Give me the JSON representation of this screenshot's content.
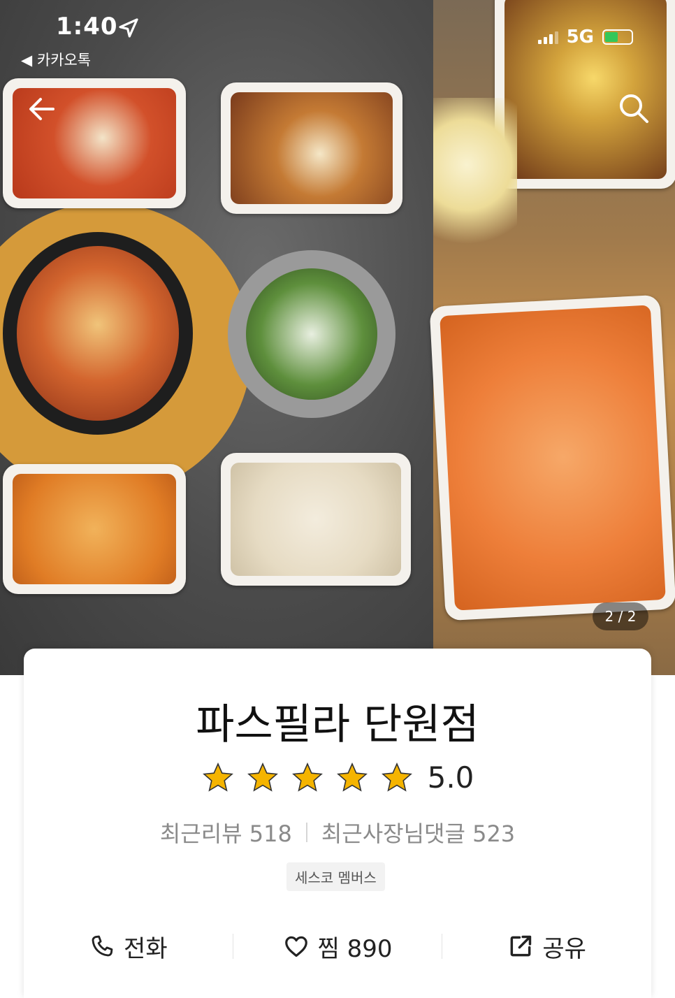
{
  "status_bar": {
    "time": "1:40",
    "back_app": "◀ 카카오톡",
    "network": "5G"
  },
  "gallery": {
    "page_indicator": "2 / 2"
  },
  "store": {
    "name": "파스필라 단원점",
    "rating": "5.0",
    "stars_filled": 5,
    "recent_reviews": "최근리뷰 518",
    "owner_comments": "최근사장님댓글 523",
    "badge": "세스코 멤버스"
  },
  "actions": {
    "call_label": "전화",
    "like_label": "찜 890",
    "share_label": "공유"
  },
  "colors": {
    "star": "#f5b400",
    "battery": "#34c759"
  }
}
